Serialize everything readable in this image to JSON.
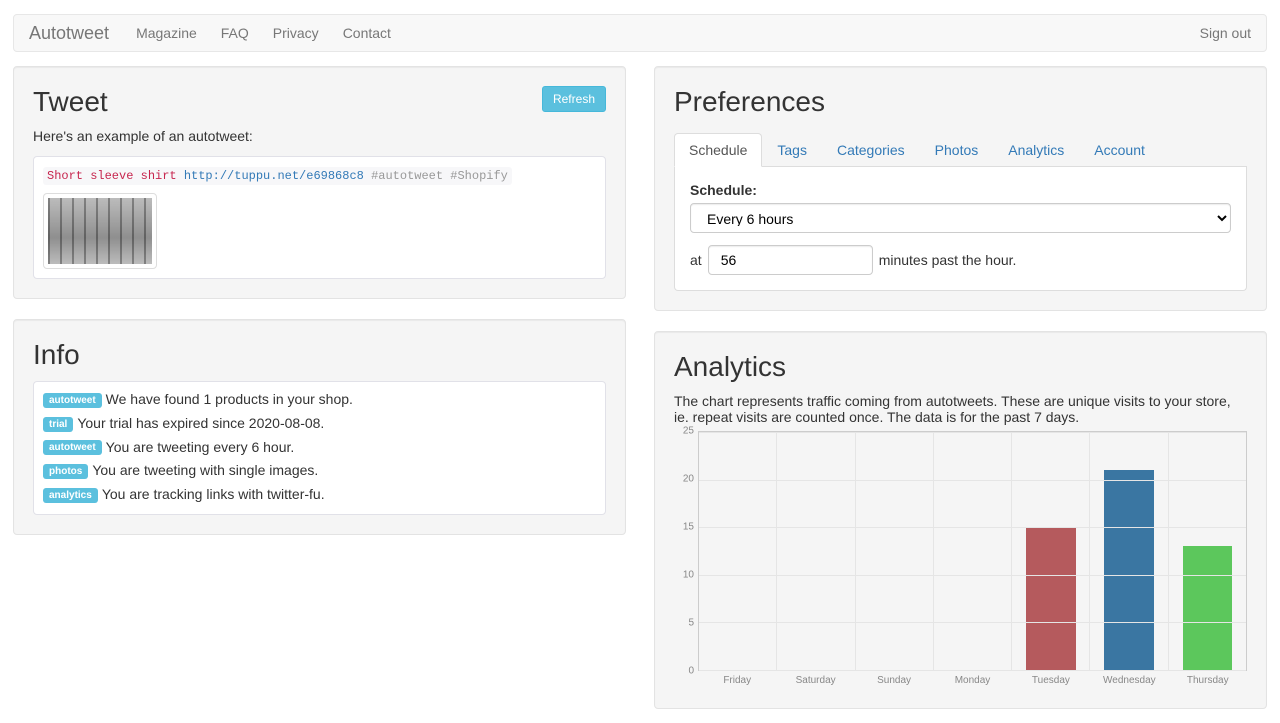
{
  "navbar": {
    "brand": "Autotweet",
    "links": [
      "Magazine",
      "FAQ",
      "Privacy",
      "Contact"
    ],
    "signout": "Sign out"
  },
  "tweet_panel": {
    "title": "Tweet",
    "refresh_label": "Refresh",
    "description": "Here's an example of an autotweet:",
    "text_red": "Short sleeve shirt",
    "text_link": "http://tuppu.net/e69868c8",
    "text_grey": "#autotweet #Shopify"
  },
  "info_panel": {
    "title": "Info",
    "items": [
      {
        "badge": "autotweet",
        "text": "We have found 1 products in your shop."
      },
      {
        "badge": "trial",
        "text": "Your trial has expired since 2020-08-08."
      },
      {
        "badge": "autotweet",
        "text": "You are tweeting every 6 hour."
      },
      {
        "badge": "photos",
        "text": "You are tweeting with single images."
      },
      {
        "badge": "analytics",
        "text": "You are tracking links with twitter-fu."
      }
    ]
  },
  "prefs_panel": {
    "title": "Preferences",
    "tabs": [
      "Schedule",
      "Tags",
      "Categories",
      "Photos",
      "Analytics",
      "Account"
    ],
    "schedule_label": "Schedule:",
    "schedule_value": "Every 6 hours",
    "at_label": "at",
    "minute_value": "56",
    "minutes_past": "minutes past the hour."
  },
  "analytics_panel": {
    "title": "Analytics",
    "description": "The chart represents traffic coming from autotweets. These are unique visits to your store, ie. repeat visits are counted once. The data is for the past 7 days."
  },
  "chart_data": {
    "type": "bar",
    "categories": [
      "Friday",
      "Saturday",
      "Sunday",
      "Monday",
      "Tuesday",
      "Wednesday",
      "Thursday"
    ],
    "values": [
      0,
      0,
      0,
      0,
      15,
      21,
      13
    ],
    "colors": [
      "#b55a5d",
      "#b55a5d",
      "#b55a5d",
      "#b55a5d",
      "#b55a5d",
      "#3a76a2",
      "#5cc75c"
    ],
    "ylim": [
      0,
      25
    ],
    "yticks": [
      0,
      5,
      10,
      15,
      20,
      25
    ]
  }
}
